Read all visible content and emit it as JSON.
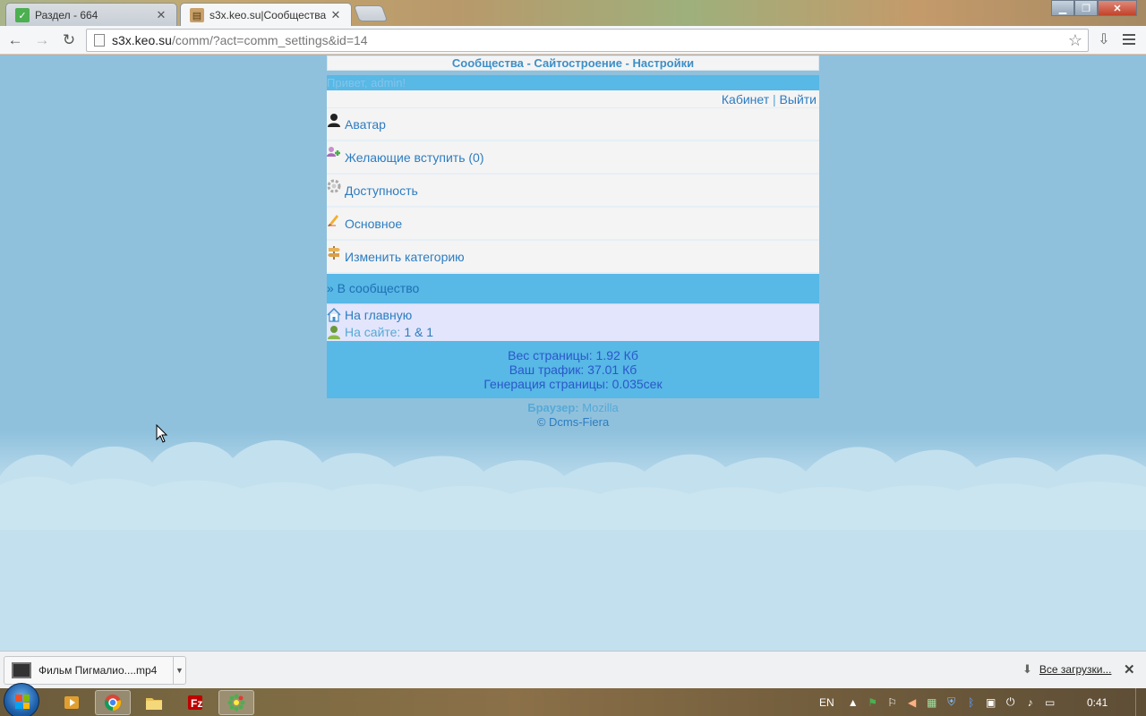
{
  "browser": {
    "tabs": [
      {
        "title": "Раздел - 664",
        "active": false
      },
      {
        "title": "s3x.keo.su|Сообщества -",
        "active": true
      }
    ],
    "address": {
      "host": "s3x.keo.su",
      "path": "/comm/?act=comm_settings&id=14"
    }
  },
  "page": {
    "header": "Сообщества - Сайтостроение - Настройки",
    "greeting": "Привет, admin!",
    "userbar": {
      "cabinet": "Кабинет",
      "separator": "|",
      "logout": "Выйти"
    },
    "menu": [
      {
        "label": "Аватар",
        "icon": "user-icon"
      },
      {
        "label": "Желающие вступить (0)",
        "icon": "users-add-icon"
      },
      {
        "label": "Доступность",
        "icon": "gear-icon"
      },
      {
        "label": "Основное",
        "icon": "pencil-icon"
      },
      {
        "label": "Изменить категорию",
        "icon": "signpost-icon"
      }
    ],
    "back_link": "» В сообщество",
    "footer": {
      "home": "На главную",
      "online_label": "На сайте:",
      "online_value": "1 & 1"
    },
    "stats": {
      "weight": "Вес страницы: 1.92 Кб",
      "traffic": "Ваш трафик: 37.01 Кб",
      "generation": "Генерация страницы: 0.035сек"
    },
    "browser_info": {
      "label": "Браузер:",
      "value": "Mozilla"
    },
    "copyright": "© Dcms-Fiera"
  },
  "downloads": {
    "file": "Фильм Пигмалио....mp4",
    "all": "Все загрузки..."
  },
  "taskbar": {
    "lang": "EN",
    "clock": "0:41"
  }
}
